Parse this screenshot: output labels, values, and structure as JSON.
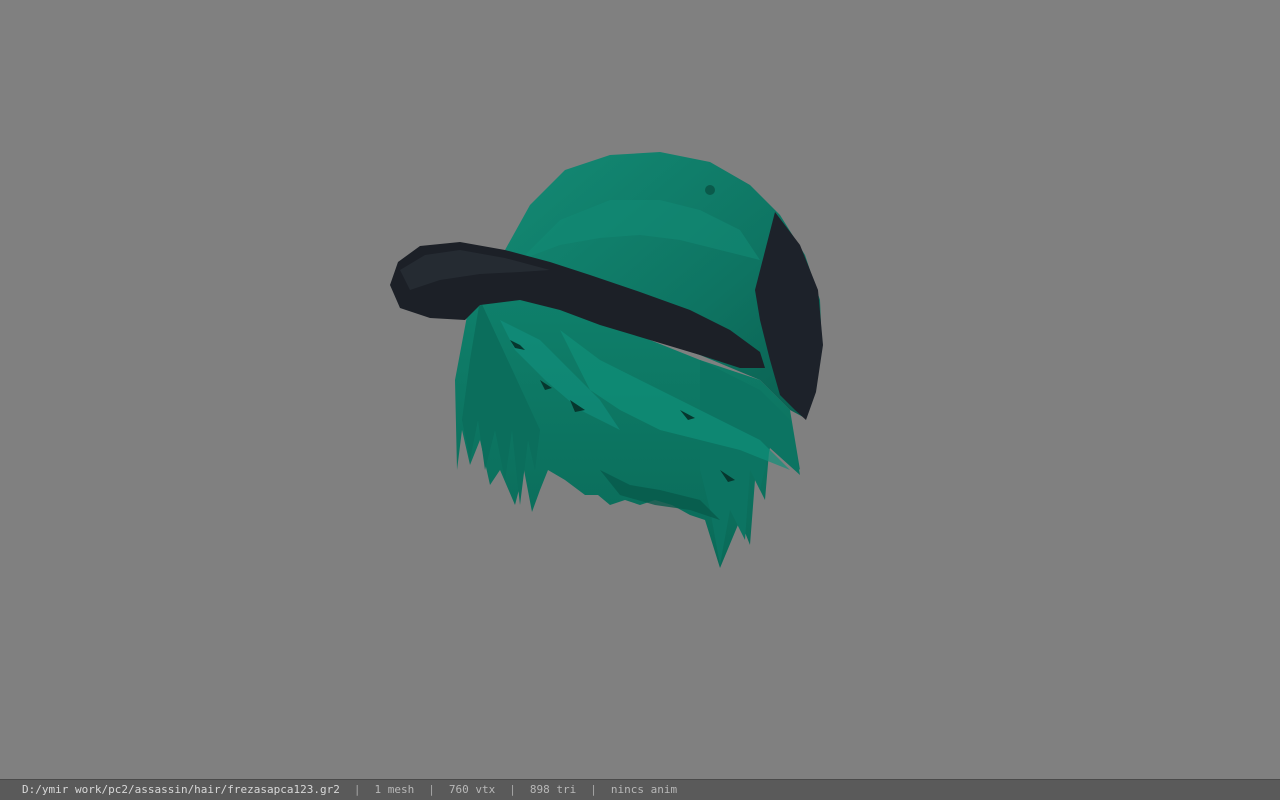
{
  "viewer": {
    "background_color": "#808080",
    "model": {
      "description_icon": "hair-cap-model-icon",
      "cap_color": "#0f7a68",
      "brim_color": "#1c2027",
      "hair_color": "#0d7a66"
    }
  },
  "status_bar": {
    "file_path": "D:/ymir work/pc2/assassin/hair/frezasapca123.gr2",
    "mesh_count": "1 mesh",
    "vertex_count": "760 vtx",
    "triangle_count": "898 tri",
    "animation": "nincs anim",
    "separator": "|"
  }
}
